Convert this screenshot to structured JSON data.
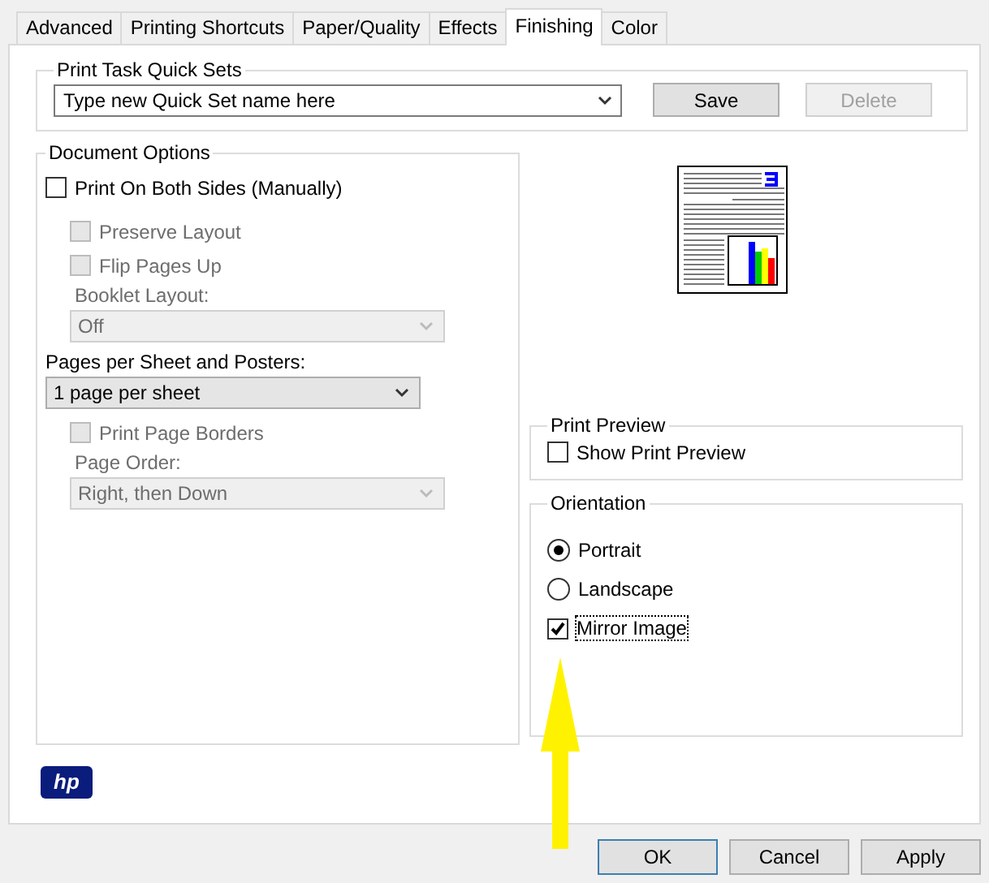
{
  "tabs": [
    {
      "label": "Advanced",
      "selected": false
    },
    {
      "label": "Printing Shortcuts",
      "selected": false
    },
    {
      "label": "Paper/Quality",
      "selected": false
    },
    {
      "label": "Effects",
      "selected": false
    },
    {
      "label": "Finishing",
      "selected": true
    },
    {
      "label": "Color",
      "selected": false
    }
  ],
  "quick_sets": {
    "title": "Print Task Quick Sets",
    "value": "Type new Quick Set name here",
    "buttons": [
      {
        "label": "Save",
        "disabled": false
      },
      {
        "label": "Delete",
        "disabled": true
      }
    ]
  },
  "document_options": {
    "title": "Document Options",
    "items": [
      {
        "kind": "checkbox",
        "label": "Print On Both Sides (Manually)",
        "checked": false,
        "disabled": false,
        "children": [
          {
            "kind": "checkbox",
            "label": "Preserve Layout",
            "checked": false,
            "disabled": true
          },
          {
            "kind": "checkbox",
            "label": "Flip Pages Up",
            "checked": false,
            "disabled": true
          },
          {
            "kind": "label",
            "label": "Booklet Layout:",
            "disabled": true
          },
          {
            "kind": "dropdown",
            "value": "Off",
            "disabled": true
          }
        ]
      },
      {
        "kind": "label",
        "label": "Pages per Sheet and Posters:",
        "disabled": false
      },
      {
        "kind": "dropdown",
        "value": "1 page per sheet",
        "disabled": false,
        "children": [
          {
            "kind": "checkbox",
            "label": "Print Page Borders",
            "checked": false,
            "disabled": true
          },
          {
            "kind": "label",
            "label": "Page Order:",
            "disabled": true
          },
          {
            "kind": "dropdown",
            "value": "Right, then Down",
            "disabled": true
          }
        ]
      }
    ]
  },
  "print_preview": {
    "title": "Print Preview",
    "label": "Show Print Preview",
    "checked": false
  },
  "orientation": {
    "title": "Orientation",
    "items": [
      {
        "kind": "radio",
        "label": "Portrait",
        "selected": true,
        "focused": false
      },
      {
        "kind": "radio",
        "label": "Landscape",
        "selected": false,
        "focused": false
      },
      {
        "kind": "checkbox",
        "label": "Mirror Image",
        "checked": true,
        "focused": true
      }
    ]
  },
  "logo": "hp",
  "buttons": [
    {
      "label": "OK",
      "default": true
    },
    {
      "label": "Cancel",
      "default": false
    },
    {
      "label": "Apply",
      "default": false
    }
  ]
}
